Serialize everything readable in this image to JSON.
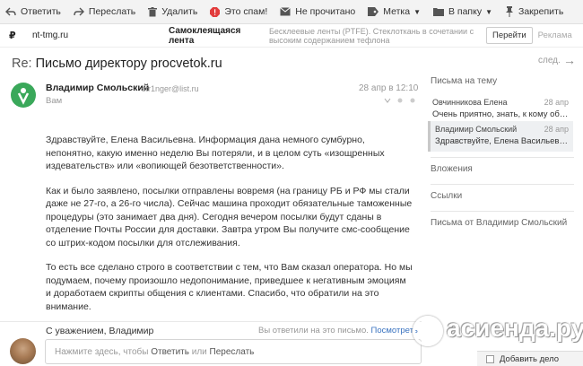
{
  "toolbar": {
    "reply": "Ответить",
    "forward": "Переслать",
    "delete": "Удалить",
    "spam": "Это спам!",
    "unread": "Не прочитано",
    "label": "Метка",
    "move": "В папку",
    "pin": "Закрепить"
  },
  "ad": {
    "logo": "₽",
    "domain": "nt-tmg.ru",
    "title": "Самоклеящаяся лента",
    "text": "Бесклеевые ленты (PTFE). Стеклоткань в сочетании с высоким содержанием тефлона",
    "go": "Перейти",
    "label": "Реклама"
  },
  "message": {
    "re": "Re:",
    "subject": "Письмо директору procvetok.ru",
    "next": "след.",
    "sender_name": "Владимир Смольский",
    "sender_email": "str1nger@list.ru",
    "to": "Вам",
    "date": "28 апр в 12:10",
    "body": [
      "Здравствуйте, Елена Васильевна. Информация дана немного сумбурно, непонятно, какую именно неделю Вы потеряли, и в целом суть «изощренных издевательств» или «вопиющей безответственности».",
      "Как и было заявлено, посылки отправлены вовремя (на границу РБ и РФ мы стали даже не 27-го, а 26-го числа). Сейчас машина проходит обязательные таможенные процедуры (это занимает два дня). Сегодня вечером посылки будут сданы в отделение Почты России для доставки. Завтра утром Вы получите смс-сообщение со штрих-кодом посылки для отслеживания.",
      "То есть все сделано строго в соответствии с тем, что Вам сказал оператора. Но мы подумаем, почему произошло недопонимание, приведшее к негативным эмоциям и доработаем скрипты общения с клиентами. Спасибо, что обратили на это внимание."
    ],
    "closing": "С уважением, Владимир"
  },
  "reply": {
    "note": "Вы ответили на это письмо.",
    "note_link": "Посмотреть",
    "placeholder_prefix": "Нажмите здесь, чтобы",
    "reply_link": "Ответить",
    "or": "или",
    "forward_link": "Переслать"
  },
  "sidebar": {
    "thread_header": "Письма на тему",
    "threads": [
      {
        "name": "Овчинникова Елена",
        "date": "28 апр",
        "snippet": "Очень приятно, знать, к кому обращ..."
      },
      {
        "name": "Владимир Смольский",
        "date": "28 апр",
        "snippet": "Здравствуйте, Елена Васильевна. ..."
      }
    ],
    "attachments": "Вложения",
    "links": "Ссылки",
    "from_sender": "Письма от Владимир Смольский"
  },
  "watermark": "асиенда.ру",
  "add_task": "Добавить дело",
  "colors": {
    "sender_logo": "#3aa85a",
    "link": "#3a73c0",
    "spam_icon": "#e23c3c"
  }
}
